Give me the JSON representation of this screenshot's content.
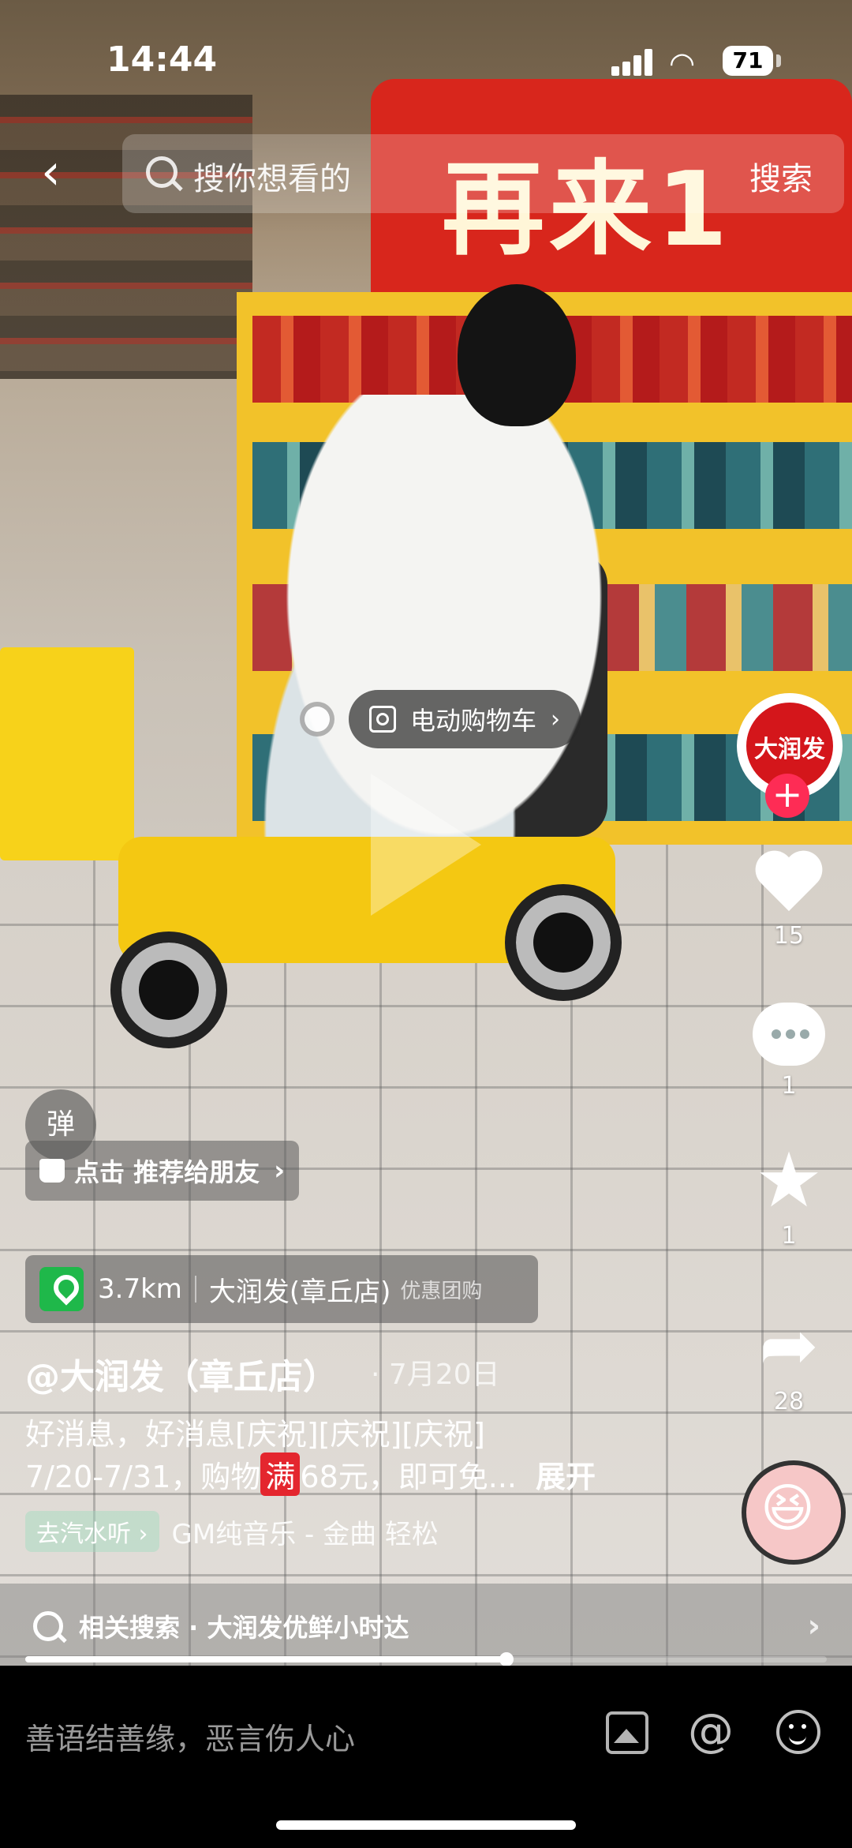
{
  "status_bar": {
    "time": "14:44",
    "battery": "71"
  },
  "search": {
    "placeholder": "搜你想看的",
    "button_label": "搜索"
  },
  "video": {
    "sign_text": "再来1",
    "product_tag_label": "电动购物车",
    "progress": 0.6
  },
  "right_rail": {
    "avatar_brand": "大润发",
    "follow_symbol": "+",
    "likes": "15",
    "comments": "1",
    "favorites": "1",
    "shares": "28"
  },
  "overlay": {
    "danmu_label": "弹",
    "recommend_label": "点击 推荐给朋友",
    "location_distance": "3.7km",
    "location_name": "大润发(章丘店)",
    "location_deal": "优惠团购",
    "author": "@大润发（章丘店）",
    "date": "· 7月20日",
    "desc_line1": "好消息，好消息[庆祝][庆祝][庆祝]",
    "desc_line2_prefix": "7/20-7/31，购物",
    "desc_line2_badge": "满",
    "desc_line2_suffix": "68元，即可免...",
    "expand_label": "展开",
    "music_chip": "去汽水听 ›",
    "music_title": "GM纯音乐 - 金曲   轻松"
  },
  "related_search": {
    "label": "相关搜索 · 大润发优鲜小时达"
  },
  "comment_bar": {
    "placeholder": "善语结善缘，恶言伤人心"
  },
  "icons": [
    "back-icon",
    "search-icon",
    "signal-icon",
    "wifi-icon",
    "battery-icon",
    "scan-icon",
    "play-icon",
    "heart-icon",
    "comment-icon",
    "star-icon",
    "share-icon",
    "music-disc-icon",
    "thumb-icon",
    "location-pin-icon",
    "image-icon",
    "at-icon",
    "emoji-icon"
  ],
  "colors": {
    "accent": "#fe2c55",
    "brand_red": "#d4161b",
    "pin_green": "#1fb84a",
    "cart_yellow": "#f4c812"
  }
}
